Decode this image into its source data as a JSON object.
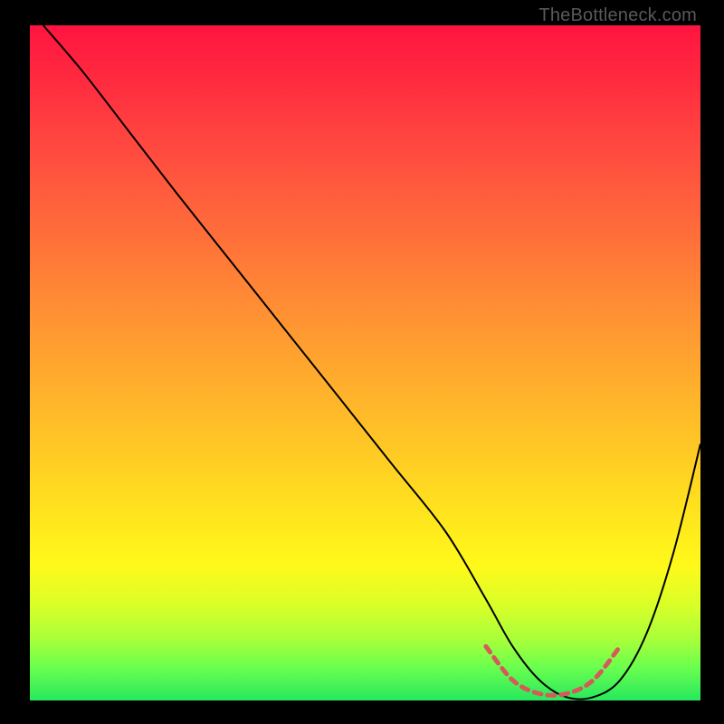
{
  "watermark": "TheBottleneck.com",
  "chart_data": {
    "type": "line",
    "title": "",
    "xlabel": "",
    "ylabel": "",
    "xlim": [
      0,
      100
    ],
    "ylim": [
      0,
      100
    ],
    "background": "rainbow-gradient-vertical",
    "series": [
      {
        "name": "black-curve",
        "color": "#000000",
        "width": 2,
        "x": [
          2,
          8,
          15,
          22,
          30,
          38,
          46,
          54,
          62,
          68,
          72,
          76,
          80,
          84,
          88,
          92,
          96,
          100
        ],
        "y": [
          100,
          93,
          84,
          75,
          65,
          55,
          45,
          35,
          25,
          15,
          8,
          3,
          0.5,
          0.5,
          3,
          10,
          22,
          38
        ]
      },
      {
        "name": "red-dashed-valley",
        "color": "#d65a5a",
        "dashed": true,
        "width": 4,
        "x": [
          68,
          72,
          76,
          80,
          84,
          88
        ],
        "y": [
          8,
          3,
          1,
          1,
          3,
          8
        ]
      }
    ]
  }
}
